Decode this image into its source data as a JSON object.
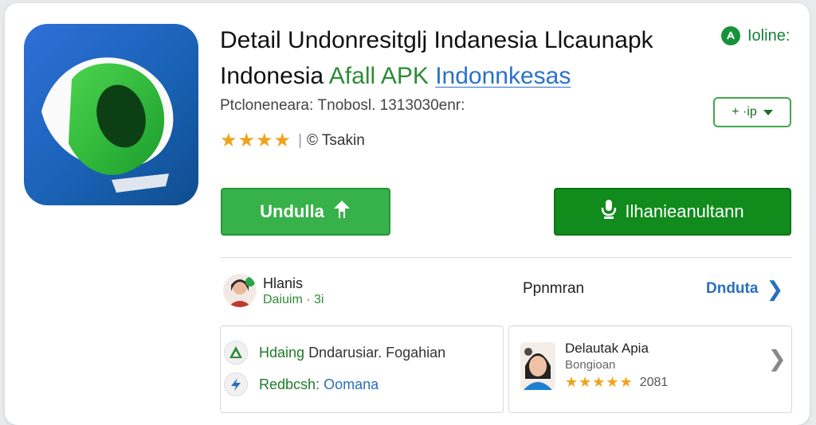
{
  "header": {
    "title_line1": "Detail Undonresitglj Indanesia Llcaunapk",
    "title_line2_black": "Indonesia",
    "title_line2_green": "Afall APK",
    "title_line2_blue": "Indonnkesas",
    "status_label": "Ioline:",
    "subinfo": "Ptclonenearа: Tnobosl. 1313030enr:",
    "dropdown_label": "+ ·ip",
    "stars": "★★★★",
    "rating_text": "© Tsakin"
  },
  "buttons": {
    "primary_label": "Undulla",
    "secondary_label": "Ilhanieanultann"
  },
  "developer": {
    "name": "Hlanis",
    "sub": "Daiuim · 3i",
    "middle": "Ppnmran",
    "link": "Dnduta",
    "chevron": "❯"
  },
  "panel_left": {
    "row1_green": "Hdaing",
    "row1_text": "Dndarusiar. Fogahian",
    "row2_green": "Redbcsh:",
    "row2_blue": "Oomana"
  },
  "panel_right": {
    "title": "Delautak Apia",
    "subtitle": "Bongioan",
    "stars": "★★★★★",
    "rating": "2081",
    "chevron": "❯"
  },
  "colors": {
    "primary_green": "#37b24a",
    "dark_green": "#118b1c",
    "link_blue": "#2a6fbd",
    "star_orange": "#f0a31a"
  },
  "icons": [
    "app-logo-icon",
    "online-status-icon",
    "dropdown-caret-icon",
    "download-arrow-icon",
    "microphone-icon",
    "avatar-icon",
    "chevron-right-icon",
    "triangle-logo-icon",
    "lightning-icon",
    "thumbnail-icon"
  ]
}
